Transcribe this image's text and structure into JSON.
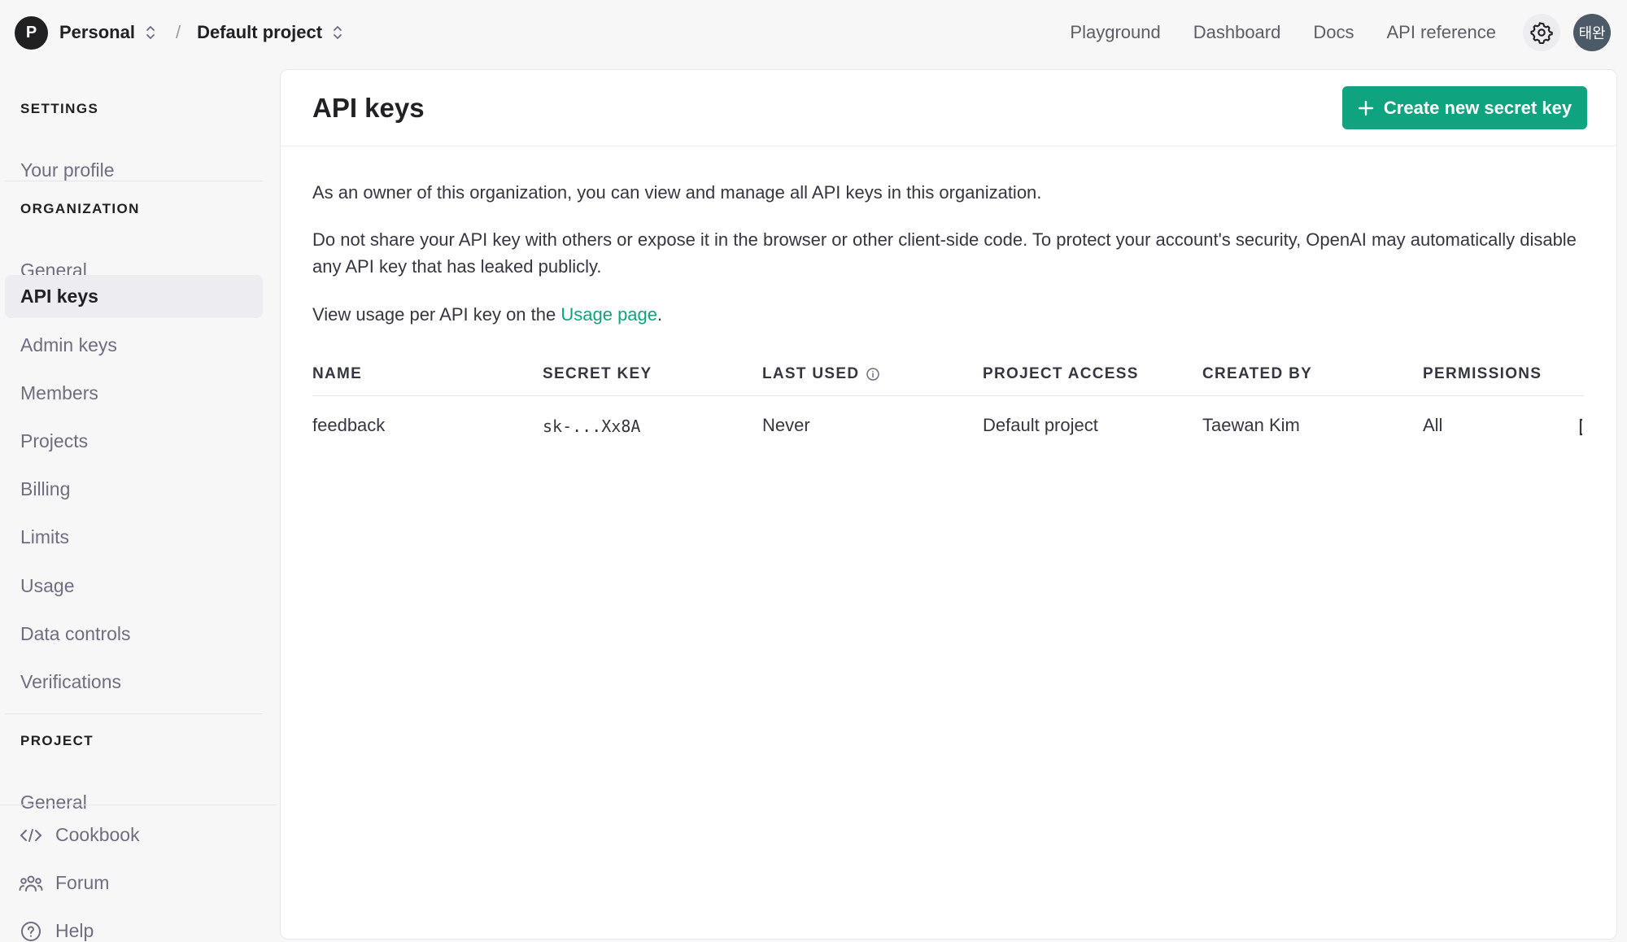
{
  "header": {
    "org_initial": "P",
    "org_name": "Personal",
    "separator": "/",
    "project_name": "Default project",
    "nav": [
      "Playground",
      "Dashboard",
      "Docs",
      "API reference"
    ],
    "user_initials": "태완"
  },
  "sidebar": {
    "settings_title": "SETTINGS",
    "settings_items": [
      "Your profile"
    ],
    "organization_title": "ORGANIZATION",
    "organization_items": [
      "General",
      "API keys",
      "Admin keys",
      "Members",
      "Projects",
      "Billing",
      "Limits",
      "Usage",
      "Data controls",
      "Verifications"
    ],
    "active_item": "API keys",
    "project_title": "PROJECT",
    "project_items": [
      "General"
    ],
    "utility_items": [
      {
        "label": "Cookbook",
        "icon": "code-icon"
      },
      {
        "label": "Forum",
        "icon": "people-icon"
      },
      {
        "label": "Help",
        "icon": "help-icon"
      }
    ]
  },
  "main": {
    "title": "API keys",
    "create_button": "Create new secret key",
    "intro": "As an owner of this organization, you can view and manage all API keys in this organization.",
    "warning": "Do not share your API key with others or expose it in the browser or other client-side code. To protect your account's security, OpenAI may automatically disable any API key that has leaked publicly.",
    "usage_prefix": "View usage per API key on the ",
    "usage_link": "Usage page",
    "usage_suffix": ".",
    "table": {
      "columns": [
        "NAME",
        "SECRET KEY",
        "LAST USED",
        "PROJECT ACCESS",
        "CREATED BY",
        "PERMISSIONS"
      ],
      "rows": [
        {
          "name": "feedback",
          "secret_key": "sk-...Xx8A",
          "last_used": "Never",
          "project_access": "Default project",
          "created_by": "Taewan Kim",
          "permissions": "All"
        }
      ]
    }
  },
  "colors": {
    "accent": "#10a37f",
    "sidebar_active_bg": "#ececf1",
    "page_bg": "#f7f7f8"
  }
}
